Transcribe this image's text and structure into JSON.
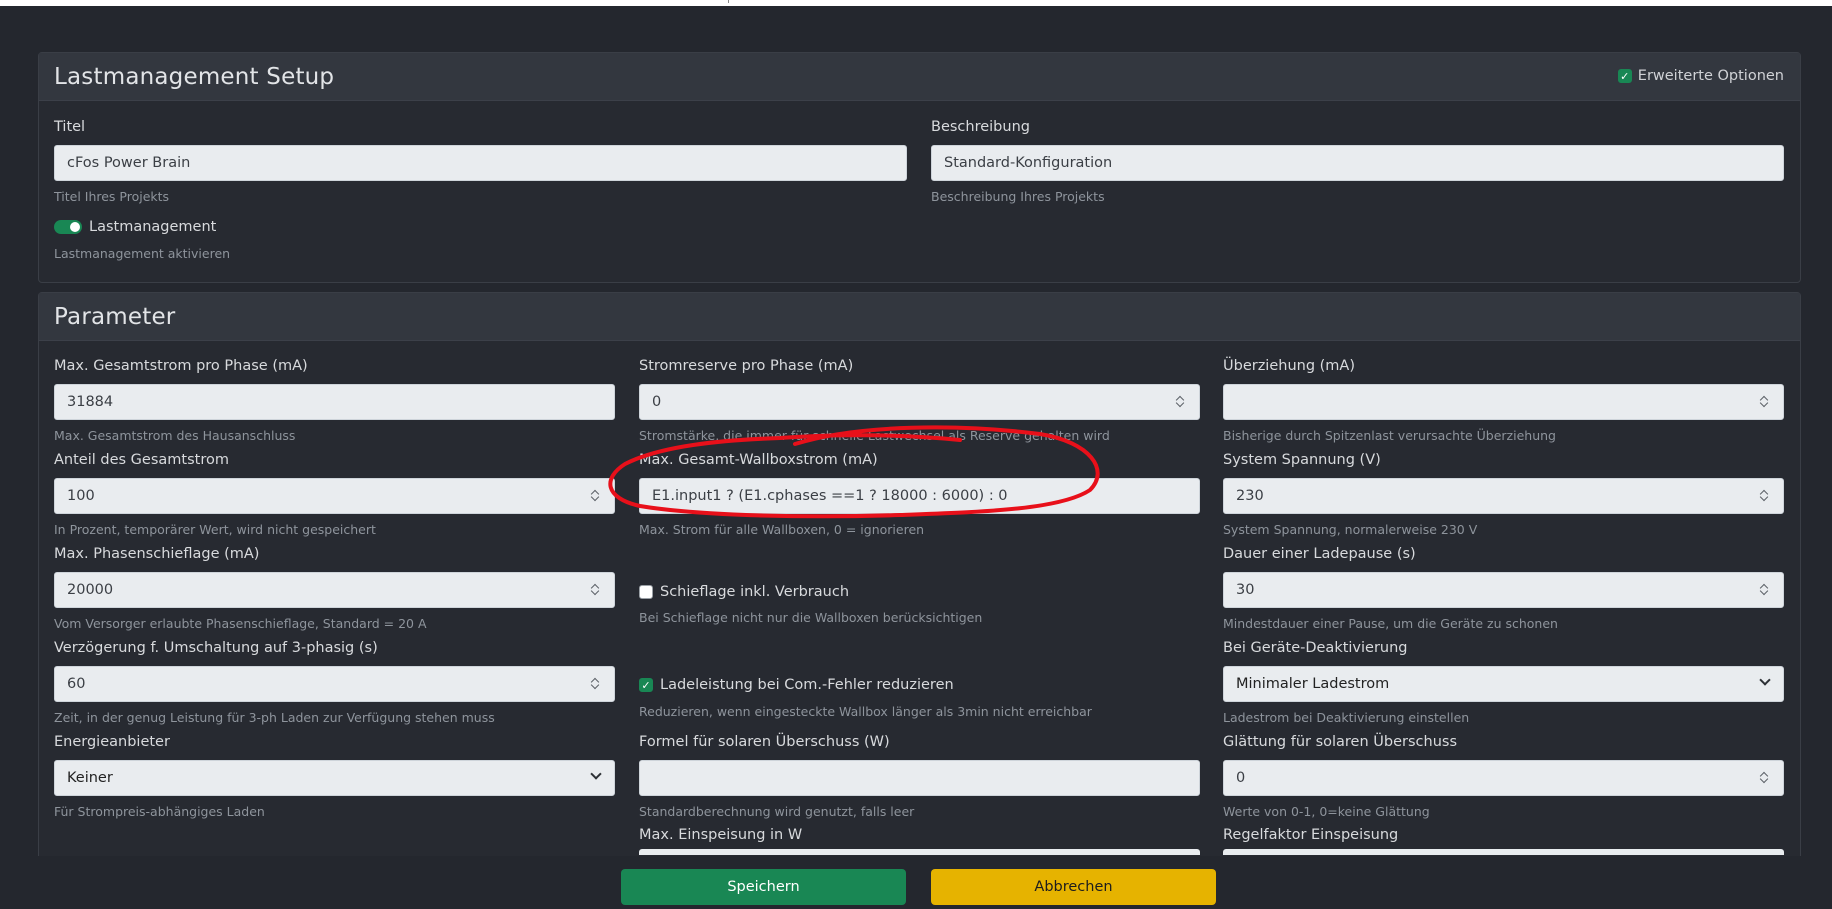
{
  "setup": {
    "title": "Lastmanagement Setup",
    "advanced_label": "Erweiterte Optionen",
    "advanced_checked": true,
    "titel": {
      "label": "Titel",
      "value": "cFos Power Brain",
      "help": "Titel Ihres Projekts"
    },
    "beschreibung": {
      "label": "Beschreibung",
      "value": "Standard-Konfiguration",
      "help": "Beschreibung Ihres Projekts"
    },
    "lastmanagement": {
      "label": "Lastmanagement",
      "enabled": true,
      "help": "Lastmanagement aktivieren"
    }
  },
  "params": {
    "title": "Parameter",
    "max_gesamtstrom": {
      "label": "Max. Gesamtstrom pro Phase (mA)",
      "value": "31884",
      "help": "Max. Gesamtstrom des Hausanschluss"
    },
    "stromreserve": {
      "label": "Stromreserve pro Phase (mA)",
      "value": "0",
      "help": "Stromstärke, die immer für schnelle Lastwechsel als Reserve gehalten wird"
    },
    "ueberziehung": {
      "label": "Überziehung (mA)",
      "value": "",
      "help": "Bisherige durch Spitzenlast verursachte Überziehung"
    },
    "anteil": {
      "label": "Anteil des Gesamtstrom",
      "value": "100",
      "help": "In Prozent, temporärer Wert, wird nicht gespeichert"
    },
    "max_wallbox": {
      "label": "Max. Gesamt-Wallboxstrom (mA)",
      "value": "E1.input1 ? (E1.cphases ==1 ? 18000 : 6000) : 0",
      "help": "Max. Strom für alle Wallboxen, 0 = ignorieren"
    },
    "spannung": {
      "label": "System Spannung (V)",
      "value": "230",
      "help": "System Spannung, normalerweise 230 V"
    },
    "phasenschieflage": {
      "label": "Max. Phasenschieflage (mA)",
      "value": "20000",
      "help": "Vom Versorger erlaubte Phasenschieflage, Standard = 20 A"
    },
    "schieflage_verbrauch": {
      "label": "Schieflage inkl. Verbrauch",
      "checked": false,
      "help": "Bei Schieflage nicht nur die Wallboxen berücksichtigen"
    },
    "ladepause": {
      "label": "Dauer einer Ladepause (s)",
      "value": "30",
      "help": "Mindestdauer einer Pause, um die Geräte zu schonen"
    },
    "verzoegerung": {
      "label": "Verzögerung f. Umschaltung auf 3-phasig (s)",
      "value": "60",
      "help": "Zeit, in der genug Leistung für 3-ph Laden zur Verfügung stehen muss"
    },
    "com_fehler": {
      "label": "Ladeleistung bei Com.-Fehler reduzieren",
      "checked": true,
      "help": "Reduzieren, wenn eingesteckte Wallbox länger als 3min nicht erreichbar"
    },
    "deaktivierung": {
      "label": "Bei Geräte-Deaktivierung",
      "value": "Minimaler Ladestrom",
      "help": "Ladestrom bei Deaktivierung einstellen"
    },
    "energieanbieter": {
      "label": "Energieanbieter",
      "value": "Keiner",
      "help": "Für Strompreis-abhängiges Laden"
    },
    "formel_solar": {
      "label": "Formel für solaren Überschuss (W)",
      "value": "",
      "help": "Standardberechnung wird genutzt, falls leer"
    },
    "glaettung": {
      "label": "Glättung für solaren Überschuss",
      "value": "0",
      "help": "Werte von 0-1, 0=keine Glättung"
    },
    "einspeisung": {
      "label": "Max. Einspeisung in W"
    },
    "regelfaktor": {
      "label": "Regelfaktor Einspeisung"
    }
  },
  "actions": {
    "save": "Speichern",
    "cancel": "Abbrechen"
  },
  "colors": {
    "accent_green": "#198754",
    "cancel_yellow": "#e6b300",
    "annotation_red": "#e8101a"
  }
}
